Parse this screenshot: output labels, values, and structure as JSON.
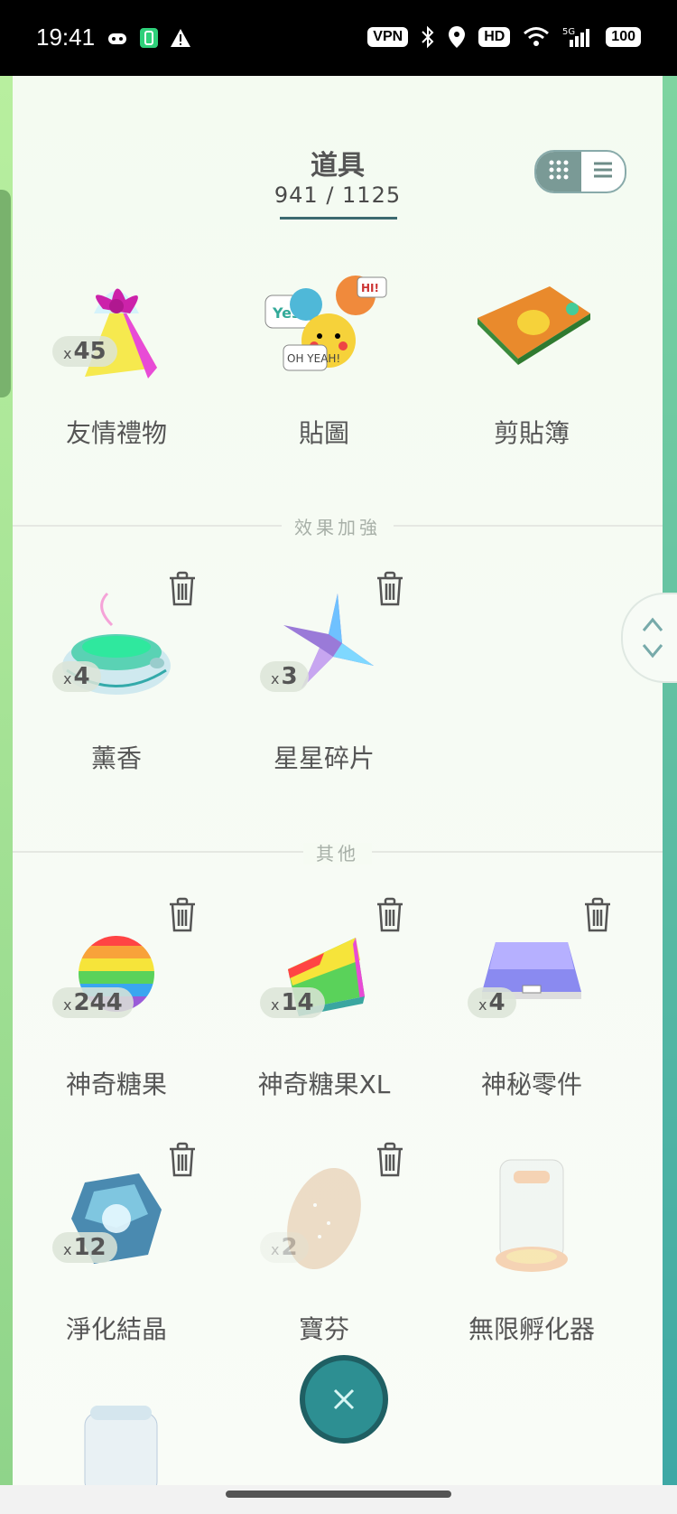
{
  "status_bar": {
    "time": "19:41",
    "left_icons": [
      "gamepad-icon",
      "battery-saver-icon",
      "warning-icon"
    ],
    "right_badges": [
      "VPN",
      "HD",
      "100"
    ],
    "right_icons": [
      "bluetooth-icon",
      "location-icon",
      "wifi-icon",
      "signal-5g-icon"
    ]
  },
  "header": {
    "title": "道具",
    "count": "941 / 1125"
  },
  "view_toggle": {
    "options": [
      "grid-view-icon",
      "list-view-icon"
    ],
    "selected": "grid"
  },
  "sections": [
    {
      "label": "",
      "items": [
        {
          "name": "友情禮物",
          "qty": "45",
          "icon": "gift-icon",
          "deletable": false
        },
        {
          "name": "貼圖",
          "qty": "",
          "icon": "sticker-icon",
          "deletable": false
        },
        {
          "name": "剪貼簿",
          "qty": "",
          "icon": "scrapbook-icon",
          "deletable": false
        }
      ]
    },
    {
      "label": "效果加強",
      "items": [
        {
          "name": "薰香",
          "qty": "4",
          "icon": "incense-icon",
          "deletable": true
        },
        {
          "name": "星星碎片",
          "qty": "3",
          "icon": "star-piece-icon",
          "deletable": true
        }
      ]
    },
    {
      "label": "其他",
      "items": [
        {
          "name": "神奇糖果",
          "qty": "244",
          "icon": "rare-candy-icon",
          "deletable": true
        },
        {
          "name": "神奇糖果XL",
          "qty": "14",
          "icon": "rare-candy-xl-icon",
          "deletable": true
        },
        {
          "name": "神秘零件",
          "qty": "4",
          "icon": "mysterious-component-icon",
          "deletable": true
        },
        {
          "name": "淨化結晶",
          "qty": "12",
          "icon": "purification-crystal-icon",
          "deletable": true
        },
        {
          "name": "寶芬",
          "qty": "2",
          "icon": "poffin-icon",
          "deletable": true
        },
        {
          "name": "無限孵化器",
          "qty": "",
          "icon": "infinite-incubator-icon",
          "deletable": false
        }
      ]
    }
  ],
  "qty_prefix": "x",
  "colors": {
    "accent": "#2d8f92",
    "panel_bg": "#f4fbf1",
    "text": "#555555"
  }
}
